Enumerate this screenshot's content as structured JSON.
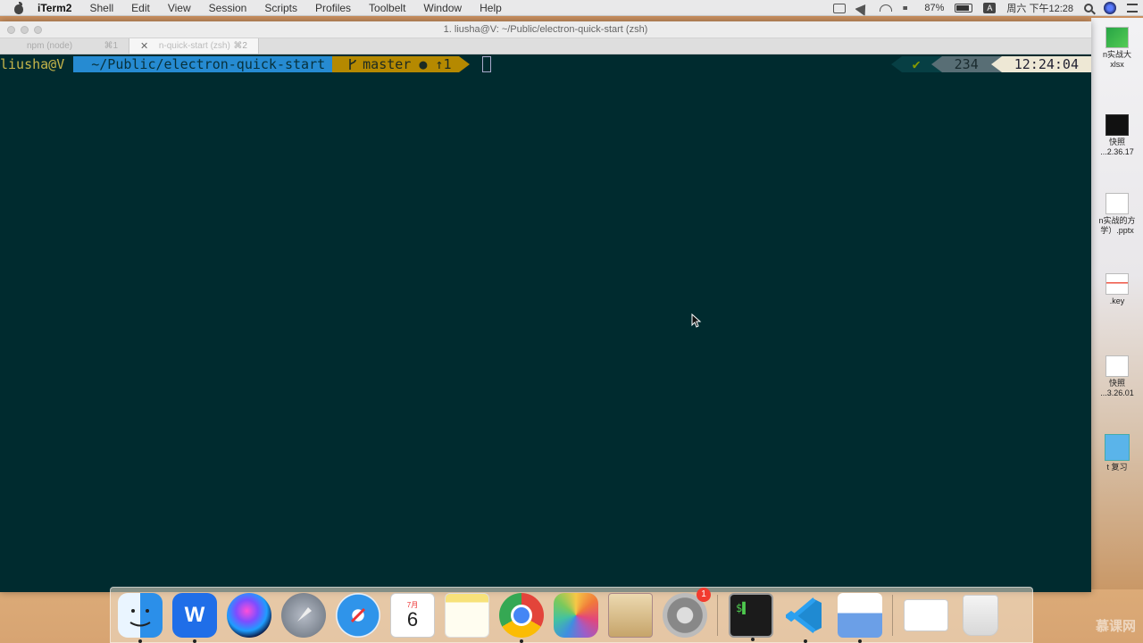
{
  "menubar": {
    "app": "iTerm2",
    "items": [
      "Shell",
      "Edit",
      "View",
      "Session",
      "Scripts",
      "Profiles",
      "Toolbelt",
      "Window",
      "Help"
    ],
    "battery": "87%",
    "datetime": "周六 下午12:28",
    "ime_label": "A"
  },
  "window": {
    "title": "1. liusha@V: ~/Public/electron-quick-start (zsh)",
    "tabs": [
      {
        "label": "npm (node)",
        "shortcut": "⌘1"
      },
      {
        "label": "n-quick-start (zsh)",
        "shortcut": "⌘2"
      }
    ]
  },
  "prompt": {
    "user": "liusha@V",
    "path": "~/Public/electron-quick-start",
    "git": "master ● ↑1",
    "git_icon": "branch-icon",
    "status": "✔",
    "history": "234",
    "time": "12:24:04"
  },
  "desktop_files": [
    {
      "label": "n实战大\nxlsx"
    },
    {
      "label": "快照\n...2.36.17"
    },
    {
      "label": "n实战的方\n学）.pptx"
    },
    {
      "label": ".key"
    },
    {
      "label": "快照\n...3.26.01"
    },
    {
      "label": "t 复习"
    }
  ],
  "dock": {
    "wps_label": "W",
    "calendar_month": "7月",
    "calendar_day": "6",
    "prefs_badge": "1",
    "terminal_label": "$▌"
  },
  "watermark": "慕课网",
  "colors": {
    "terminal_bg": "#002b2f",
    "path_segment": "#268bd2",
    "git_segment": "#b58900",
    "time_segment": "#eee8d5"
  }
}
